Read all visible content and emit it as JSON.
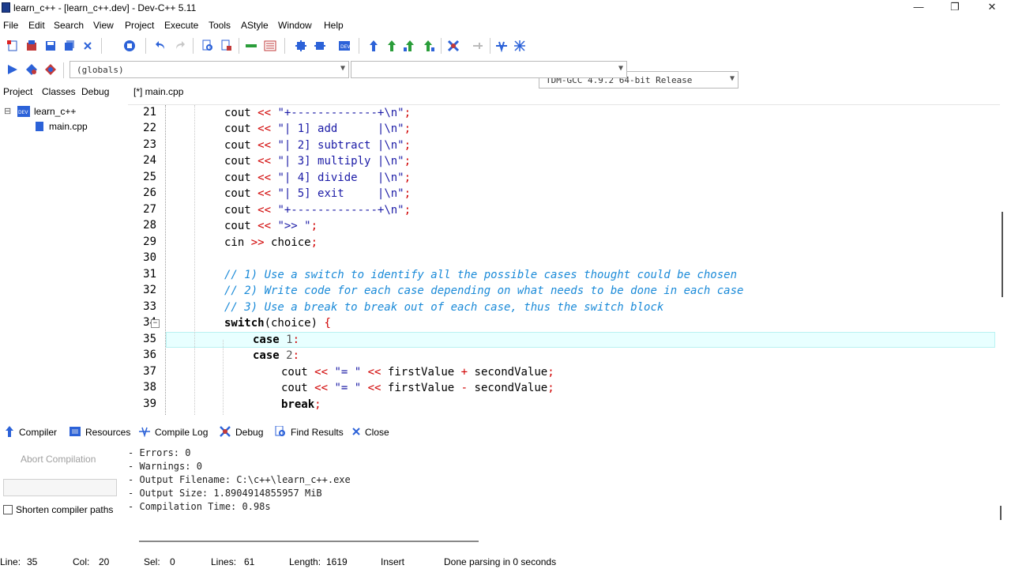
{
  "window": {
    "title": "learn_c++ - [learn_c++.dev] - Dev-C++ 5.11",
    "minimize_glyph": "—",
    "restore_glyph": "❐",
    "close_glyph": "✕"
  },
  "menu": [
    "File",
    "Edit",
    "Search",
    "View",
    "Project",
    "Execute",
    "Tools",
    "AStyle",
    "Window",
    "Help"
  ],
  "toolbar": {
    "compiler_select": "TDM-GCC 4.9.2 64-bit Release",
    "scope_select": "(globals)",
    "function_select": ""
  },
  "left_pane": {
    "tabs": [
      "Project",
      "Classes",
      "Debug"
    ],
    "tree": {
      "project_name": "learn_c++",
      "file_name": "main.cpp",
      "expander": "⊟"
    }
  },
  "editor": {
    "tab_label": "[*] main.cpp",
    "line_numbers": [
      "21",
      "22",
      "23",
      "24",
      "25",
      "26",
      "27",
      "28",
      "29",
      "30",
      "31",
      "32",
      "33",
      "34",
      "35",
      "36",
      "37",
      "38",
      "39"
    ],
    "fold_marker": "−"
  },
  "code": {
    "cout": "cout",
    "cin": "cin",
    "op_out": "<<",
    "op_in": ">>",
    "semi": ";",
    "s_border": "\"+-------------+\\n\"",
    "s_add": "\"| 1] add      |\\n\"",
    "s_sub": "\"| 2] subtract |\\n\"",
    "s_mul": "\"| 3] multiply |\\n\"",
    "s_div": "\"| 4] divide   |\\n\"",
    "s_exit": "\"| 5] exit     |\\n\"",
    "s_prompt": "\">> \"",
    "choice": "choice",
    "c31": "// 1) Use a switch to identify all the possible cases thought could be chosen",
    "c32": "// 2) Write code for each case depending on what needs to be done in each case",
    "c33": "// 3) Use a break to break out of each case, thus the switch block",
    "kw_switch": "switch",
    "switch_arg": "(choice)",
    "brace": "{",
    "kw_case": "case",
    "n1": "1",
    "n2": "2",
    "colon": ":",
    "s_eq": "\"= \"",
    "first": "firstValue",
    "second": "secondValue",
    "plus": "+",
    "minus": "-",
    "kw_break": "break"
  },
  "bottom_pane": {
    "tabs": [
      "Compiler",
      "Resources",
      "Compile Log",
      "Debug",
      "Find Results",
      "Close"
    ],
    "abort_label": "Abort Compilation",
    "shorten_label": "Shorten compiler paths",
    "log_lines": [
      "- Errors: 0",
      "- Warnings: 0",
      "- Output Filename: C:\\c++\\learn_c++.exe",
      "- Output Size: 1.8904914855957 MiB",
      "- Compilation Time: 0.98s"
    ]
  },
  "status": {
    "line_label": "Line:",
    "line_value": "35",
    "col_label": "Col:",
    "col_value": "20",
    "sel_label": "Sel:",
    "sel_value": "0",
    "lines_label": "Lines:",
    "lines_value": "61",
    "length_label": "Length:",
    "length_value": "1619",
    "mode": "Insert",
    "message": "Done parsing in 0 seconds"
  },
  "colors": {
    "keyword": "#000000",
    "string": "#1a1aa6",
    "operator": "#d00000",
    "comment": "#1a8ad8",
    "active_line": "#e8ffff"
  }
}
